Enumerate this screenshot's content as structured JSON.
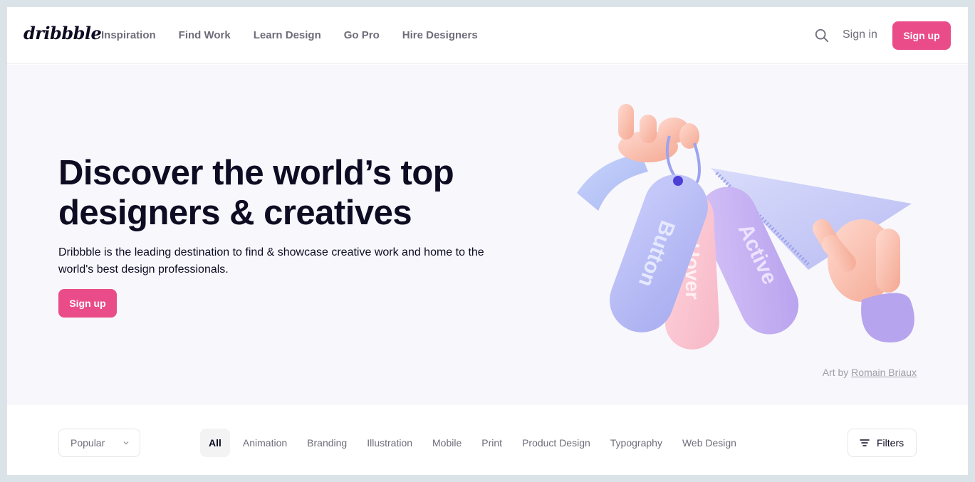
{
  "header": {
    "logo": "dribbble",
    "nav": [
      "Inspiration",
      "Find Work",
      "Learn Design",
      "Go Pro",
      "Hire Designers"
    ],
    "signin": "Sign in",
    "signup": "Sign up"
  },
  "hero": {
    "title_line1": "Discover the world’s top",
    "title_line2": "designers & creatives",
    "description": "Dribbble is the leading destination to find & showcase creative work and home to the world's best design professionals.",
    "signup": "Sign up",
    "art_tags": [
      "Button",
      "Hover",
      "Active"
    ],
    "credit_prefix": "Art by ",
    "credit_author": "Romain Briaux"
  },
  "filterbar": {
    "sort_value": "Popular",
    "categories": [
      "All",
      "Animation",
      "Branding",
      "Illustration",
      "Mobile",
      "Print",
      "Product Design",
      "Typography",
      "Web Design"
    ],
    "active_category": "All",
    "filters_label": "Filters"
  },
  "colors": {
    "brand_pink": "#ea4c89",
    "hero_bg": "#f8f7fc",
    "text_dark": "#0d0c22",
    "text_muted": "#6e6d7a"
  }
}
